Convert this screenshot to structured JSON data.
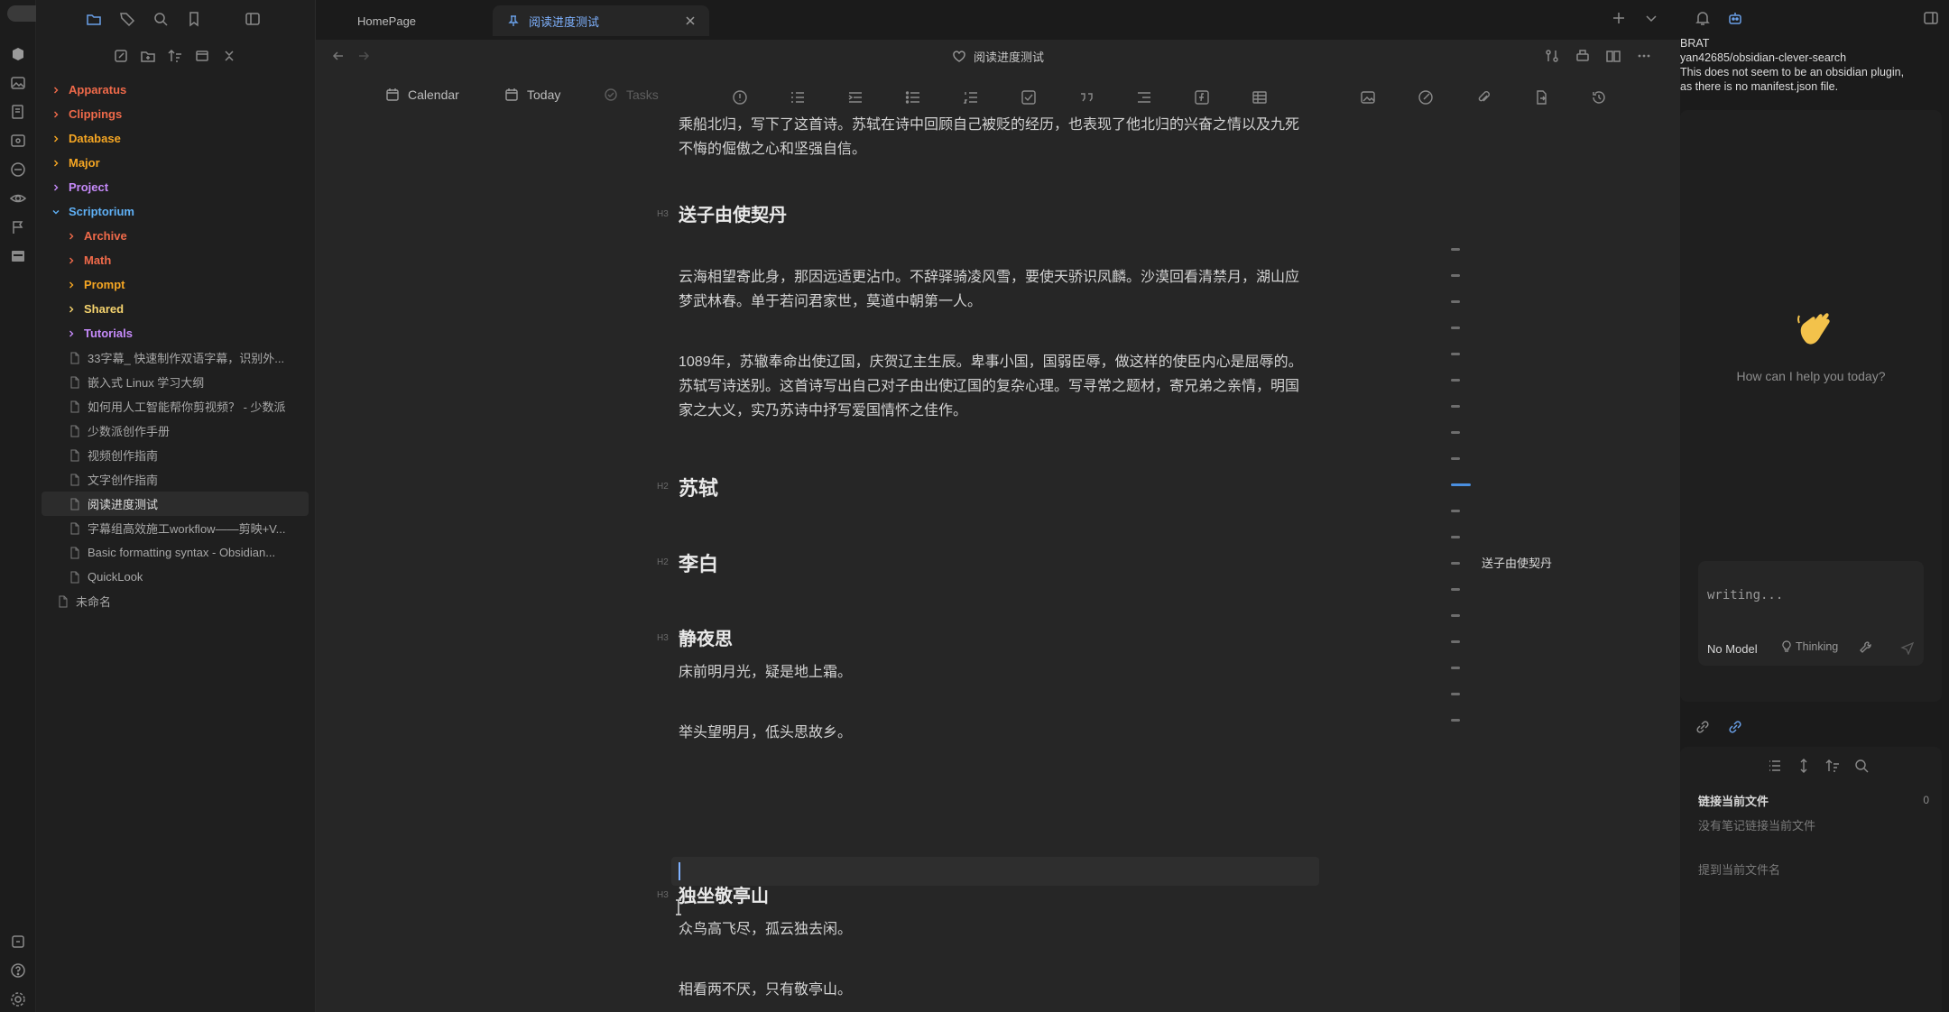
{
  "tabs": [
    {
      "label": "HomePage"
    },
    {
      "label": "阅读进度测试"
    }
  ],
  "sidebar": {
    "tree": [
      {
        "label": "Apparatus",
        "type": "folder",
        "color": "#f06a4a"
      },
      {
        "label": "Clippings",
        "type": "folder",
        "color": "#f06a4a"
      },
      {
        "label": "Database",
        "type": "folder",
        "color": "#f5a623"
      },
      {
        "label": "Major",
        "type": "folder",
        "color": "#f5a623"
      },
      {
        "label": "Project",
        "type": "folder",
        "color": "#c58af9"
      },
      {
        "label": "Scriptorium",
        "type": "folder-open",
        "color": "#5fb0f5"
      },
      {
        "label": "Archive",
        "type": "folder",
        "color": "#f06a4a"
      },
      {
        "label": "Math",
        "type": "folder",
        "color": "#f06a4a"
      },
      {
        "label": "Prompt",
        "type": "folder",
        "color": "#f5a623"
      },
      {
        "label": "Shared",
        "type": "folder",
        "color": "#f5d36e"
      },
      {
        "label": "Tutorials",
        "type": "folder",
        "color": "#c58af9"
      },
      {
        "label": "33字幕_ 快速制作双语字幕，识别外...",
        "type": "file"
      },
      {
        "label": "嵌入式 Linux 学习大纲",
        "type": "file"
      },
      {
        "label": "如何用人工智能帮你剪视频？ - 少数派",
        "type": "file"
      },
      {
        "label": "少数派创作手册",
        "type": "file"
      },
      {
        "label": "视频创作指南",
        "type": "file"
      },
      {
        "label": "文字创作指南",
        "type": "file"
      },
      {
        "label": "阅读进度测试",
        "type": "file",
        "active": true
      },
      {
        "label": "字幕组高效施工workflow——剪映+V...",
        "type": "file"
      },
      {
        "label": "Basic formatting syntax - Obsidian...",
        "type": "file"
      },
      {
        "label": "QuickLook",
        "type": "file"
      },
      {
        "label": "未命名",
        "type": "file"
      }
    ]
  },
  "editor": {
    "title": "阅读进度测试",
    "toolbar": {
      "calendar": "Calendar",
      "today": "Today",
      "tasks": "Tasks"
    },
    "content": {
      "p0_line1": "乘船北归，写下了这首诗。苏轼在诗中回顾自己被贬的经历，也表现了他北归的兴奋之情以及九死",
      "p0_line2": "不悔的倔傲之心和坚强自信。",
      "h_songzi": "送子由使契丹",
      "p1_line1": "云海相望寄此身，那因远适更沾巾。不辞驿骑凌风雪，要使天骄识凤麟。沙漠回看清禁月，湖山应",
      "p1_line2": "梦武林春。单于若问君家世，莫道中朝第一人。",
      "p2_line1": "1089年，苏辙奉命出使辽国，庆贺辽主生辰。卑事小国，国弱臣辱，做这样的使臣内心是屈辱的。",
      "p2_line2": "苏轼写诗送别。这首诗写出自己对子由出使辽国的复杂心理。写寻常之题材，寄兄弟之亲情，明国",
      "p2_line3": "家之大义，实乃苏诗中抒写爱国情怀之佳作。",
      "h_sushi": "苏轼",
      "h_libai": "李白",
      "h_jingyesi": "静夜思",
      "p3": "床前明月光，疑是地上霜。",
      "p4": "举头望明月，低头思故乡。",
      "h_duzuo": "独坐敬亭山",
      "p5": "众鸟高飞尽，孤云独去闲。",
      "p6": "相看两不厌，只有敬亭山。",
      "heading_markers": {
        "h3": "H3",
        "h2": "H2"
      }
    },
    "outline_active": "送子由使契丹"
  },
  "right_panel": {
    "notice_title": "BRAT",
    "notice_line1": "yan42685/obsidian-clever-search",
    "notice_line2": "This does not seem to be an obsidian plugin,",
    "notice_line3": "as there is no manifest.json file.",
    "chat": {
      "greeting": "How can I help you today?",
      "placeholder": "writing...",
      "model": "No Model",
      "thinking": "Thinking"
    },
    "links": {
      "title": "链接当前文件",
      "count": "0",
      "empty": "没有笔记链接当前文件",
      "mentions": "提到当前文件名"
    }
  },
  "colors": {
    "accent": "#4a8fe0",
    "background": "#262626"
  }
}
